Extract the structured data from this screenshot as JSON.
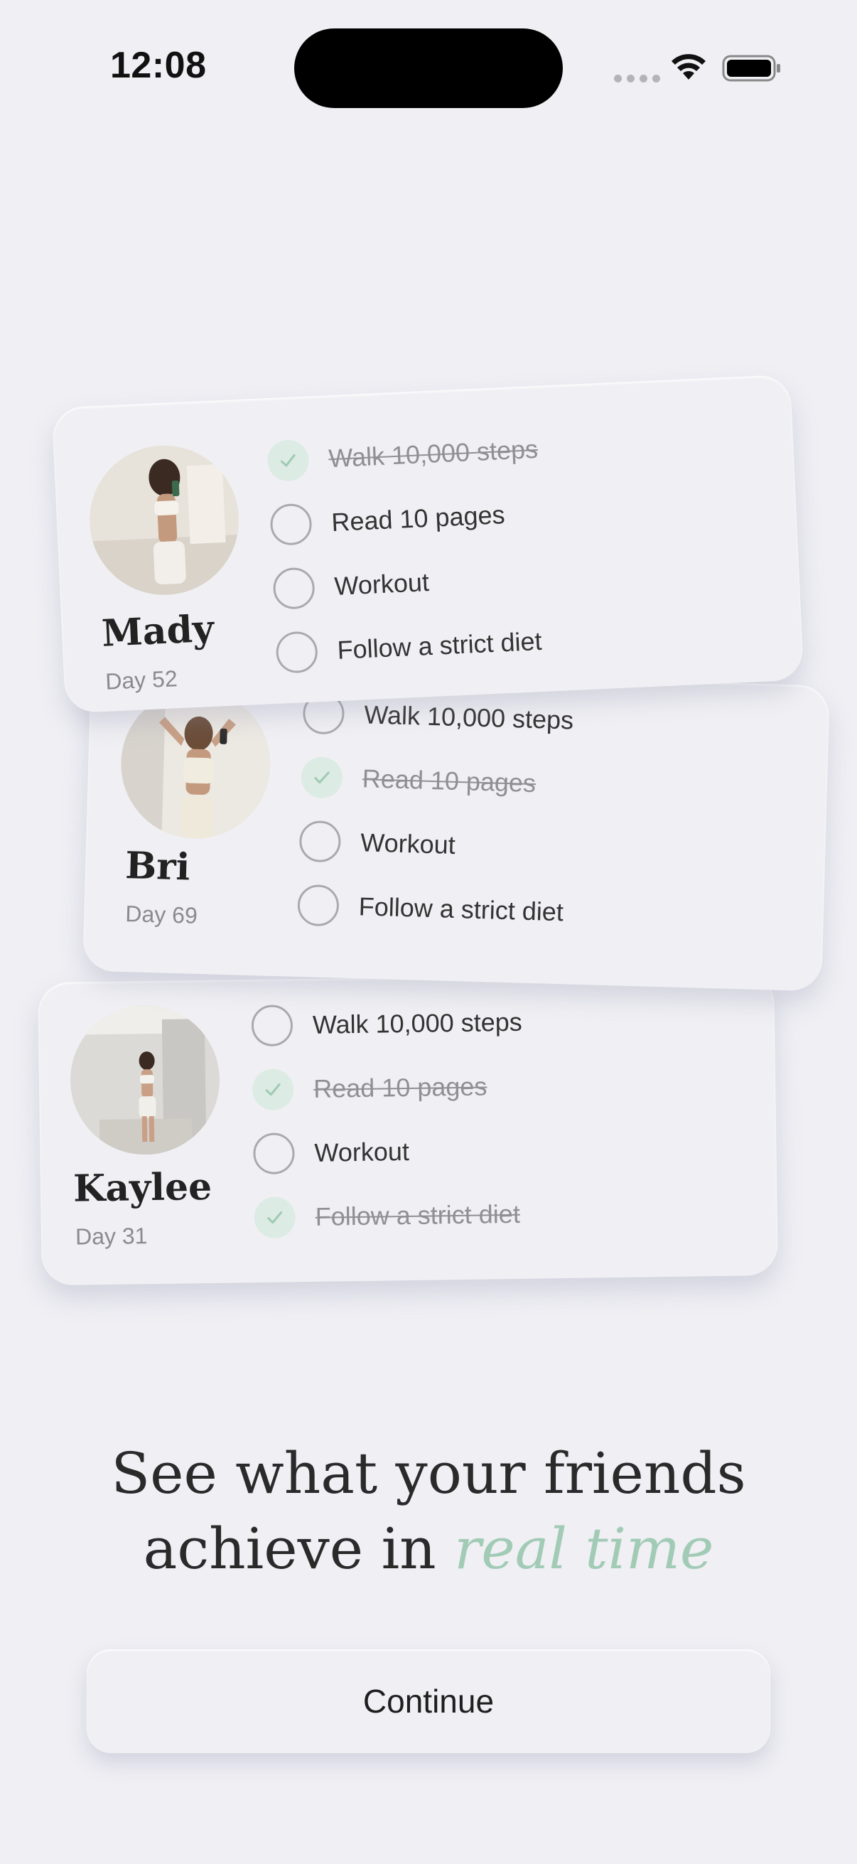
{
  "status_bar": {
    "time": "12:08"
  },
  "friends": [
    {
      "name": "Mady",
      "day": "Day 52",
      "tasks": [
        {
          "label": "Walk 10,000 steps",
          "done": true
        },
        {
          "label": "Read 10 pages",
          "done": false
        },
        {
          "label": "Workout",
          "done": false
        },
        {
          "label": "Follow a strict diet",
          "done": false
        }
      ]
    },
    {
      "name": "Bri",
      "day": "Day 69",
      "tasks": [
        {
          "label": "Walk 10,000 steps",
          "done": false
        },
        {
          "label": "Read 10 pages",
          "done": true
        },
        {
          "label": "Workout",
          "done": false
        },
        {
          "label": "Follow a strict diet",
          "done": false
        }
      ]
    },
    {
      "name": "Kaylee",
      "day": "Day 31",
      "tasks": [
        {
          "label": "Walk 10,000 steps",
          "done": false
        },
        {
          "label": "Read 10 pages",
          "done": true
        },
        {
          "label": "Workout",
          "done": false
        },
        {
          "label": "Follow a strict diet",
          "done": true
        }
      ]
    }
  ],
  "headline": {
    "line1": "See what your friends",
    "line2_prefix": "achieve in ",
    "line2_accent": "real time"
  },
  "continue_label": "Continue",
  "colors": {
    "accent": "#a2cbb6",
    "check_fill": "#dcebe3",
    "background": "#efeff4"
  },
  "icons": [
    "wifi-icon",
    "battery-icon",
    "checkmark-icon"
  ]
}
